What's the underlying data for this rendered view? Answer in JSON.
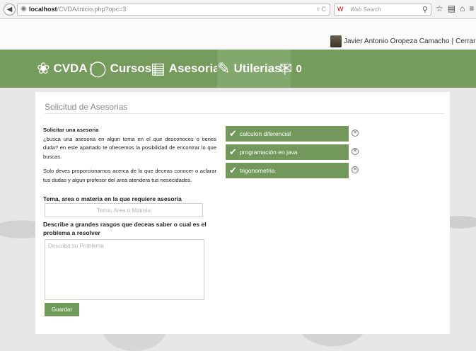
{
  "browser": {
    "url_host": "localhost",
    "url_path": "/CVDA/inicio.php?opc=3",
    "search_placeholder": "Web Search",
    "search_engine": "W"
  },
  "user": {
    "name": "Javier Antonio Oropeza Camacho",
    "separator": "|",
    "logout_label": "Cerrar Sesión"
  },
  "nav": {
    "brand": "CVDA",
    "items": [
      {
        "label": "Cursos",
        "icon": "globe-icon"
      },
      {
        "label": "Asesorias",
        "icon": "document-icon"
      },
      {
        "label": "Utilerias",
        "icon": "tools-icon"
      }
    ],
    "separator": "|",
    "inbox_count": "0",
    "inbox_icon": "envelope-icon"
  },
  "panel": {
    "title": "Solicitud de Asesorias",
    "intro_heading": "Solicitar una asesoria",
    "intro_p1": "¿busca una asesoria en algun tema en el que desconoces o tienes duda? en este apartado te ofrecemos la posibilidad de encontrar lo que buscas.",
    "intro_p2": "Solo deves proporcionarnos acerca de lo que deceas conocer o aclarar tus dudas y algun profesor del area atendera tus nesecidades.",
    "topic_label": "Tema, area o materia en la que requiere asesoria",
    "topic_placeholder": "Tema, Area o Materia",
    "desc_label": "Describe a grandes rasgos que deceas saber o cual es el problema a resolver",
    "desc_placeholder": "Describa su Problema",
    "save_label": "Guardar"
  },
  "requests": [
    {
      "label": "calculon diferencial"
    },
    {
      "label": "programación en java"
    },
    {
      "label": "trigonometria"
    }
  ],
  "colors": {
    "nav_green": "#759b5d",
    "pill_green": "#72995b",
    "button_green": "#6f9a5a"
  }
}
